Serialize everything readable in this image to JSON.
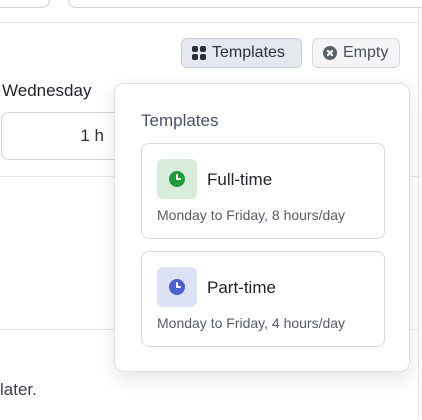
{
  "toolbar": {
    "templates_label": "Templates",
    "empty_label": "Empty"
  },
  "schedule": {
    "day_label": "Wednesday",
    "hours_value": "1 h"
  },
  "footer": {
    "partial_text": "later."
  },
  "popover": {
    "title": "Templates",
    "templates": [
      {
        "name": "Full-time",
        "description": "Monday to Friday, 8 hours/day",
        "accent": "#1f9a3a"
      },
      {
        "name": "Part-time",
        "description": "Monday to Friday, 4 hours/day",
        "accent": "#4b5fcf"
      }
    ]
  },
  "icons": {
    "templates_button": "grid-icon",
    "empty_button": "x-circle-icon",
    "template_cards": "clock-icon"
  }
}
